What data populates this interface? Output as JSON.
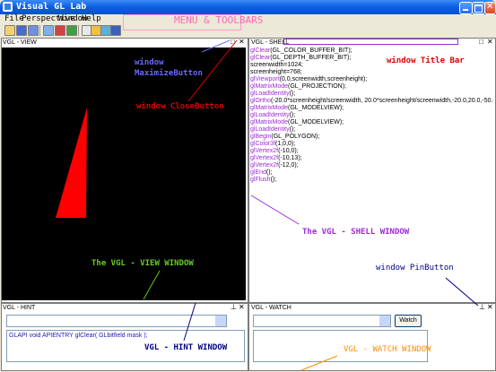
{
  "window": {
    "title": "Visual GL Lab"
  },
  "menu": [
    {
      "label": "File",
      "key": "F"
    },
    {
      "label": "Perspective",
      "key": "P"
    },
    {
      "label": "Window",
      "key": "W"
    },
    {
      "label": "Help",
      "key": "H"
    }
  ],
  "toolbar": {
    "icons": [
      "open-file-icon",
      "save-icon",
      "save-all-icon",
      "refresh-icon",
      "import-icon",
      "export-icon",
      "window-icon",
      "edit-icon",
      "settings-icon",
      "palette-icon"
    ]
  },
  "view_panel": {
    "title": "VGL - VIEW"
  },
  "shell_panel": {
    "title": "VGL - SHELL",
    "lines": [
      {
        "fn": "glClear",
        "args": "(GL_COLOR_BUFFER_BIT);"
      },
      {
        "fn": "glClear",
        "args": "(GL_DEPTH_BUFFER_BIT);"
      },
      {
        "fn": "",
        "args": "screenwidth=1024;"
      },
      {
        "fn": "",
        "args": "screenheight=768;"
      },
      {
        "fn": "glViewport",
        "args": "(0,0,screenwidth,screenheight);"
      },
      {
        "fn": "glMatrixMode",
        "args": "(GL_PROJECTION);"
      },
      {
        "fn": "glLoadIdentity",
        "args": "();"
      },
      {
        "fn": "glOrtho",
        "args": "(-20.0*screenheight/screenwidth, 20.0*screenheight/screenwidth,-20.0,20.0,-50.0"
      },
      {
        "fn": "glMatrixMode",
        "args": "(GL_MODELVIEW);"
      },
      {
        "fn": "glLoadIdentity",
        "args": "();"
      },
      {
        "fn": "glMatrixMode",
        "args": "(GL_MODELVIEW);"
      },
      {
        "fn": "glLoadIdentity",
        "args": "();"
      },
      {
        "fn": "glBegin",
        "args": "(GL_POLYGON);"
      },
      {
        "fn": "glColor3f",
        "args": "(1,0,0);"
      },
      {
        "fn": "glVertex2f",
        "args": "(-10,0);"
      },
      {
        "fn": "glVertex2f",
        "args": "(-10,13);"
      },
      {
        "fn": "glVertex2f",
        "args": "(-12,0);"
      },
      {
        "fn": "glEnd",
        "args": "();"
      },
      {
        "fn": "glFlush",
        "args": "();"
      }
    ]
  },
  "hint_panel": {
    "title": "VGL - HINT",
    "text": "GLAPI void APIENTRY glClear( GLbitfield mask );"
  },
  "watch_panel": {
    "title": "VGL - WATCH",
    "button": "Watch"
  },
  "annotations": {
    "menu_toolbars": "MENU & TOOLBARS",
    "maximize": "window\nMaximizeButton",
    "close": "window CloseButton",
    "title_bar": "window Title Bar",
    "shell_window": "The VGL - SHELL WINDOW",
    "view_window": "The VGL - VIEW WINDOW",
    "pin_button": "window PinButton",
    "hint_window": "VGL - HINT WINDOW",
    "watch_window": "VGL - WATCH WINDOW"
  },
  "colors": {
    "view_bg": "#000000",
    "triangle": "#ff0000",
    "annot_pink": "#ff69b4",
    "annot_blue": "#6a6aff",
    "annot_red": "#e00000",
    "annot_purple": "#9b2bd8",
    "annot_green": "#66cc22",
    "annot_orange": "#ff8c00",
    "annot_navy": "#000080",
    "code_keyword": "#9b2bd8"
  }
}
